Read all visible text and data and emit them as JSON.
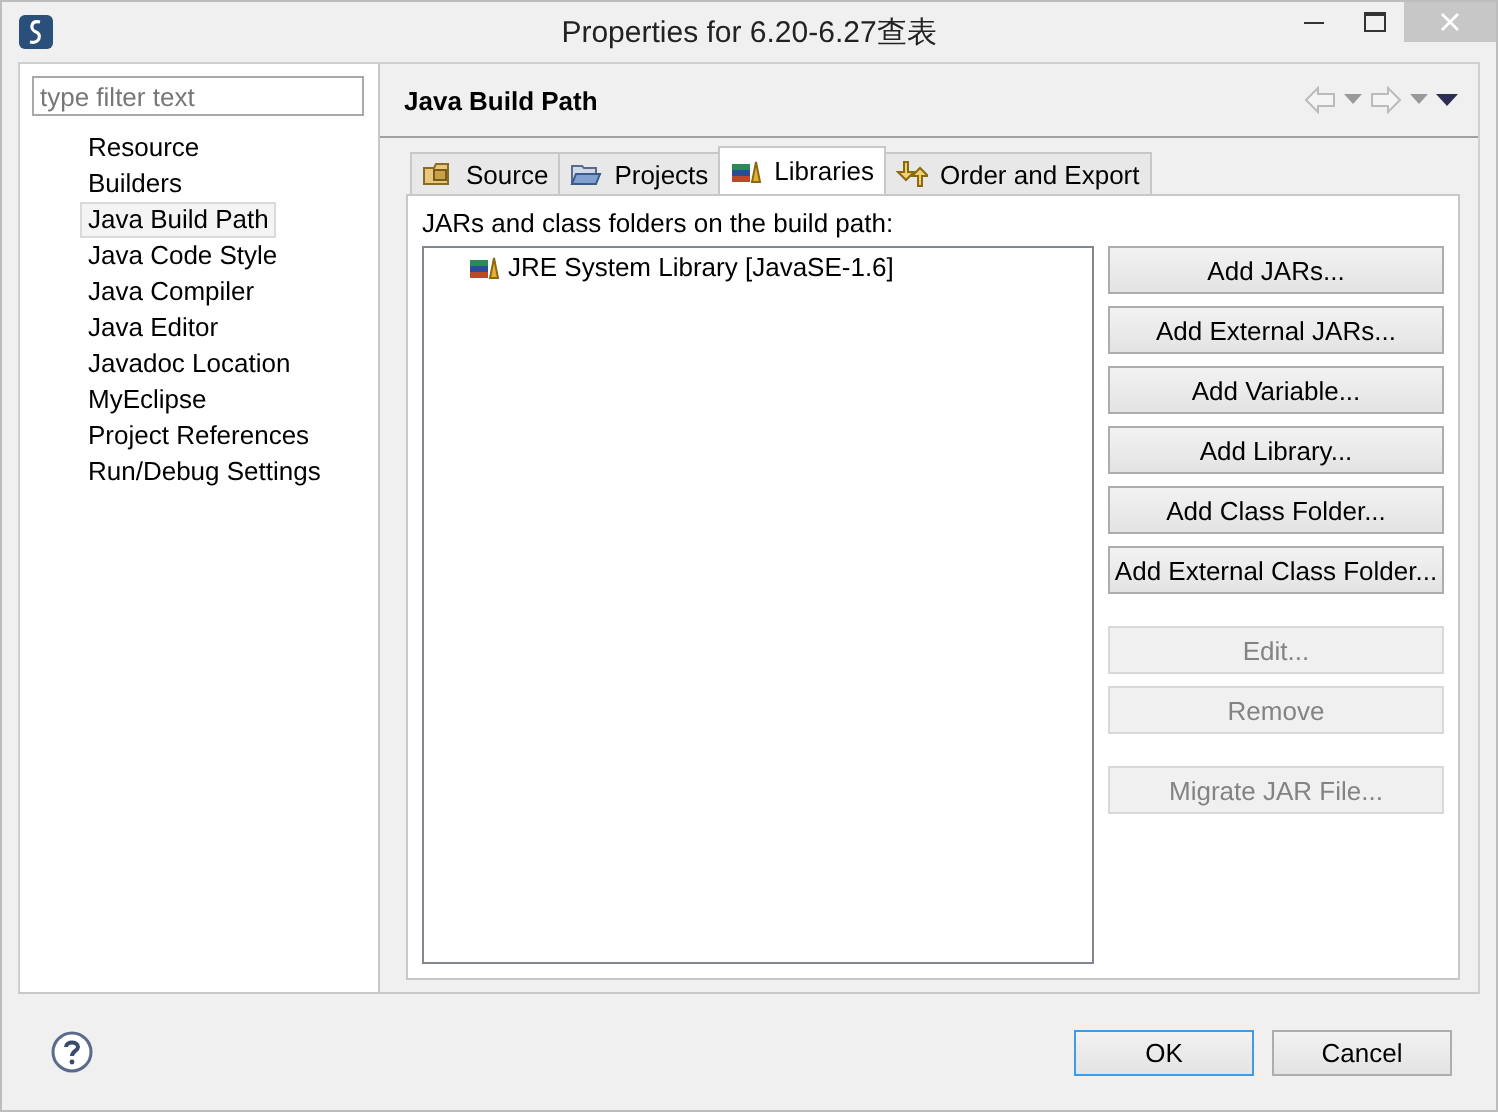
{
  "window": {
    "title": "Properties for 6.20-6.27查表"
  },
  "filter": {
    "placeholder": "type filter text"
  },
  "sidebar": {
    "items": [
      {
        "label": "Resource",
        "selected": false
      },
      {
        "label": "Builders",
        "selected": false
      },
      {
        "label": "Java Build Path",
        "selected": true
      },
      {
        "label": "Java Code Style",
        "selected": false
      },
      {
        "label": "Java Compiler",
        "selected": false
      },
      {
        "label": "Java Editor",
        "selected": false
      },
      {
        "label": "Javadoc Location",
        "selected": false
      },
      {
        "label": "MyEclipse",
        "selected": false
      },
      {
        "label": "Project References",
        "selected": false
      },
      {
        "label": "Run/Debug Settings",
        "selected": false
      }
    ]
  },
  "page": {
    "title": "Java Build Path"
  },
  "tabs": [
    {
      "label": "Source",
      "selected": false,
      "kind": "source"
    },
    {
      "label": "Projects",
      "selected": false,
      "kind": "projects"
    },
    {
      "label": "Libraries",
      "selected": true,
      "kind": "libraries"
    },
    {
      "label": "Order and Export",
      "selected": false,
      "kind": "order"
    }
  ],
  "libraries": {
    "caption": "JARs and class folders on the build path:",
    "entries": [
      {
        "label": "JRE System Library [JavaSE-1.6]"
      }
    ],
    "buttons": [
      {
        "label": "Add JARs...",
        "disabled": false
      },
      {
        "label": "Add External JARs...",
        "disabled": false
      },
      {
        "label": "Add Variable...",
        "disabled": false
      },
      {
        "label": "Add Library...",
        "disabled": false
      },
      {
        "label": "Add Class Folder...",
        "disabled": false
      },
      {
        "label": "Add External Class Folder...",
        "disabled": false,
        "gap_after": true
      },
      {
        "label": "Edit...",
        "disabled": true
      },
      {
        "label": "Remove",
        "disabled": true,
        "gap_after": true
      },
      {
        "label": "Migrate JAR File...",
        "disabled": true
      }
    ]
  },
  "footer": {
    "buttons": [
      {
        "label": "OK",
        "default": true
      },
      {
        "label": "Cancel",
        "default": false
      }
    ]
  }
}
